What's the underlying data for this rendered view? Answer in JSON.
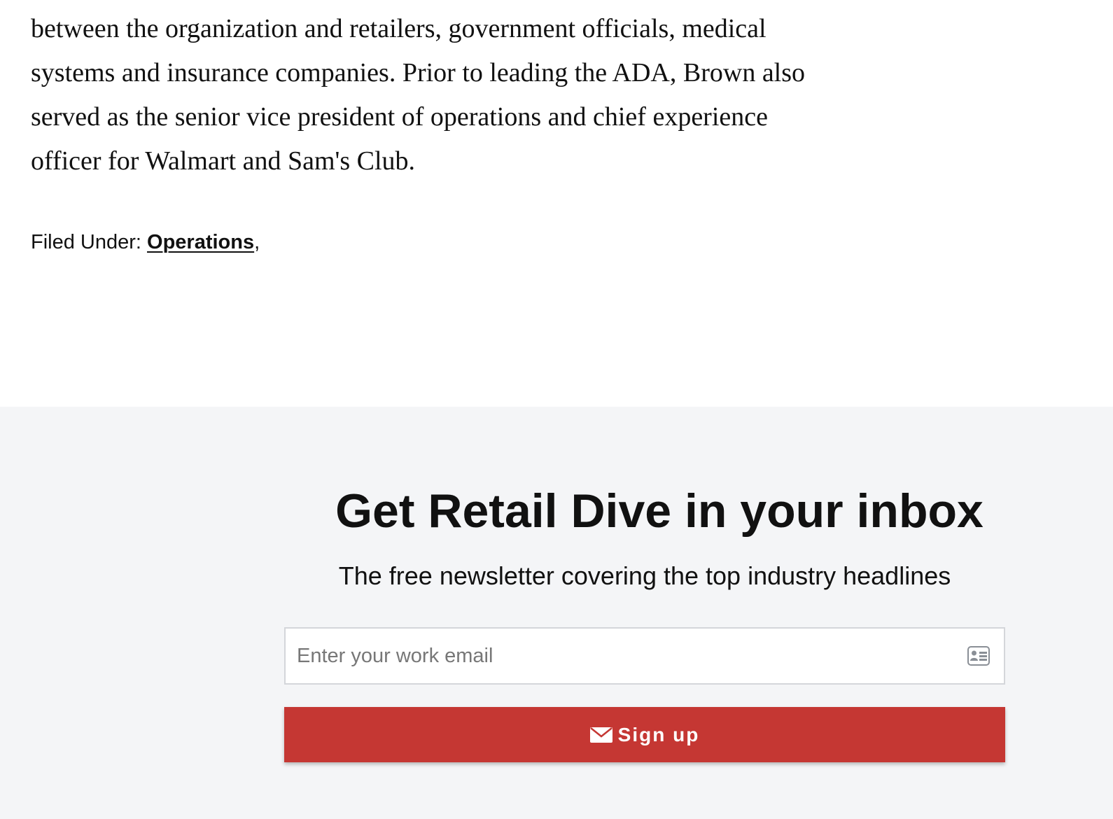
{
  "article": {
    "lines": [
      "between the organization and retailers, government officials, medical",
      "systems and insurance companies. Prior to leading the ADA, Brown also",
      "served as the senior vice president of operations and chief experience",
      "officer for Walmart and Sam's Club."
    ],
    "filed_under_label": "Filed Under:",
    "filed_under_link": "Operations",
    "filed_under_suffix": ","
  },
  "newsletter": {
    "title": "Get Retail Dive in your inbox",
    "subtitle": "The free newsletter covering the top industry headlines",
    "email_placeholder": "Enter your work email",
    "email_value": "",
    "contact_icon": "contact-card-icon",
    "button_icon": "envelope-icon",
    "button_label": "Sign up",
    "button_color": "#c53733",
    "section_background": "#f4f5f7"
  }
}
